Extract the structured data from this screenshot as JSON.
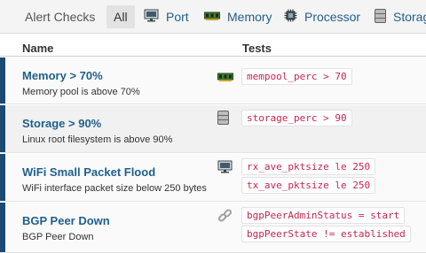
{
  "tabs": {
    "title": "Alert Checks",
    "all": "All",
    "items": [
      {
        "label": "Port",
        "icon": "network-port-icon"
      },
      {
        "label": "Memory",
        "icon": "memory-chip-icon"
      },
      {
        "label": "Processor",
        "icon": "processor-chip-icon"
      },
      {
        "label": "Storage",
        "icon": "storage-disk-icon"
      }
    ]
  },
  "table": {
    "headers": [
      "Name",
      "Tests"
    ],
    "rows": [
      {
        "name": "Memory > 70%",
        "description": "Memory pool is above 70%",
        "icon": "memory-chip-icon",
        "tests": [
          "mempool_perc > 70"
        ]
      },
      {
        "name": "Storage > 90%",
        "description": "Linux root filesystem is above 90%",
        "icon": "storage-disk-icon",
        "tests": [
          "storage_perc > 90"
        ]
      },
      {
        "name": "WiFi Small Packet Flood",
        "description": "WiFi interface packet size below 250 bytes",
        "icon": "network-port-icon",
        "tests": [
          "rx_ave_pktsize le 250",
          "tx_ave_pktsize le 250"
        ]
      },
      {
        "name": "BGP Peer Down",
        "description": "BGP Peer Down",
        "icon": "link-icon",
        "tests": [
          "bgpPeerAdminStatus = start",
          "bgpPeerState != established"
        ]
      }
    ]
  },
  "colors": {
    "accent_bar": "#1c4a73",
    "link": "#1f5f8b",
    "code_text": "#c7254e"
  }
}
